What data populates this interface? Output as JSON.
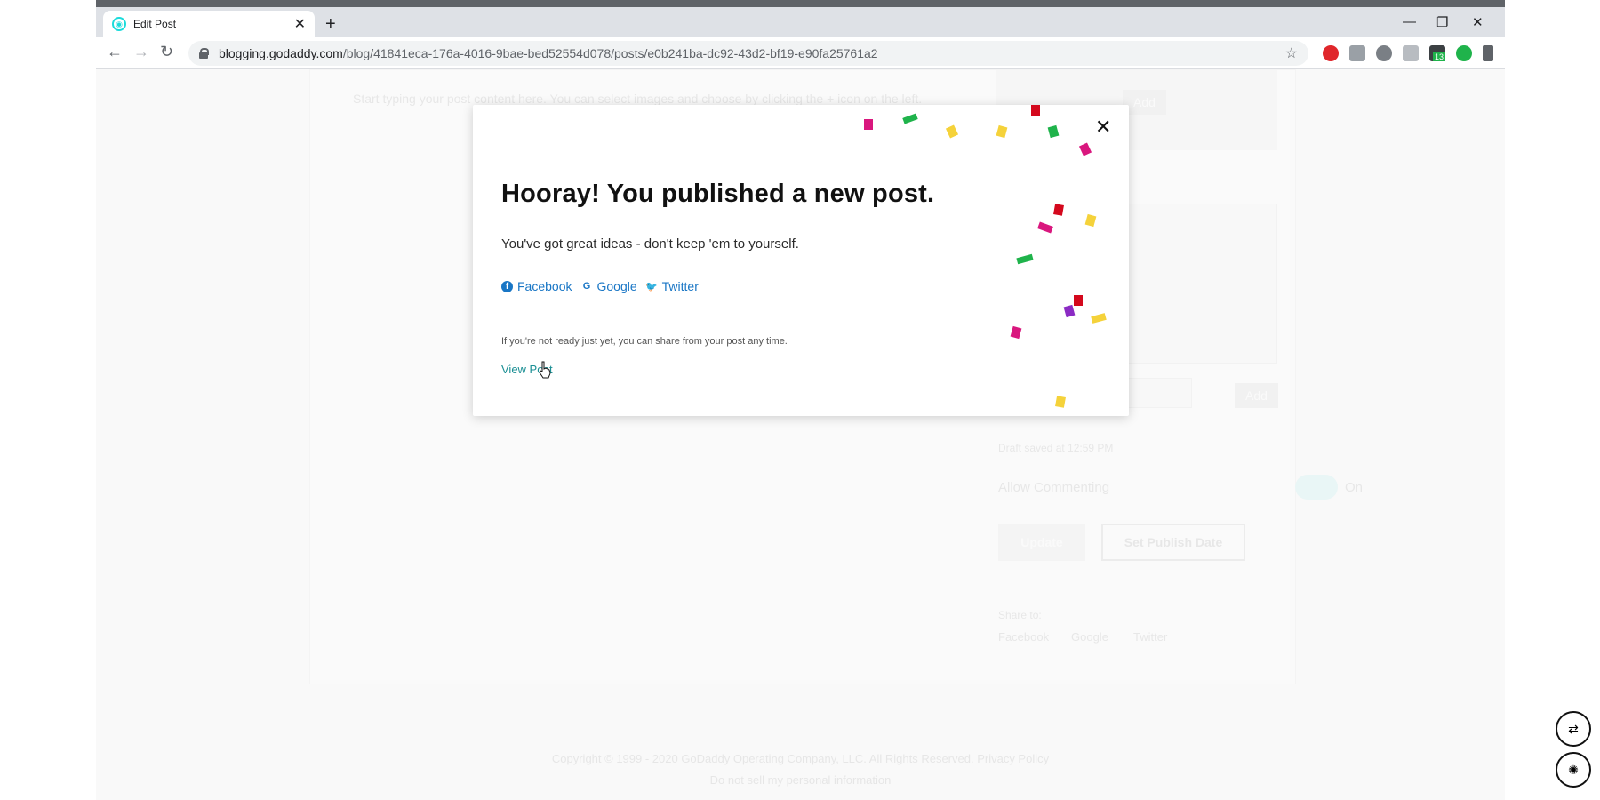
{
  "browser": {
    "tab_title": "Edit Post",
    "tab_close": "✕",
    "new_tab": "+",
    "window_controls": {
      "minimize": "—",
      "restore": "❐",
      "close": "✕"
    },
    "nav": {
      "back": "←",
      "forward": "→",
      "reload": "↻",
      "menu": "⋮"
    },
    "url_host": "blogging.godaddy.com",
    "url_path": "/blog/41841eca-176a-4016-9bae-bed52554d078/posts/e0b241ba-dc92-43d2-bf19-e90fa25761a2",
    "bookmark_icon": "☆",
    "extension_badge": "13"
  },
  "background_page": {
    "editor_hint": "Start typing your post content here. You can select images and choose by clicking the + icon on the left.",
    "add_button": "Add",
    "add_button_2": "Add",
    "draft_saved": "Draft saved at 12:59 PM",
    "allow_commenting": "Allow Commenting",
    "toggle_state": "On",
    "update_button": "Update",
    "set_publish_date_button": "Set Publish Date",
    "share_to": "Share to:",
    "share_links": [
      "Facebook",
      "Google",
      "Twitter"
    ],
    "footer_copyright": "Copyright © 1999 - 2020 GoDaddy Operating Company, LLC. All Rights Reserved.",
    "footer_privacy": "Privacy Policy",
    "footer_do_not_sell": "Do not sell my personal information"
  },
  "modal": {
    "close": "✕",
    "title": "Hooray! You published a new post.",
    "subtitle": "You've got great ideas - don't keep 'em to yourself.",
    "share": [
      {
        "label": "Facebook",
        "icon": "f"
      },
      {
        "label": "Google",
        "icon": "G"
      },
      {
        "label": "Twitter",
        "icon": "🐦"
      }
    ],
    "note": "If you're not ready just yet, you can share from your post any time.",
    "view_post": "View Post"
  },
  "side_widgets": {
    "translate_icon": "⇄",
    "brain_icon": "✺"
  },
  "colors": {
    "link_blue": "#1976c5",
    "view_post_teal": "#1b8f94",
    "confetti_pink": "#d9177e",
    "confetti_green": "#1fb34b",
    "confetti_yellow": "#f5d23a",
    "confetti_red": "#d4081d",
    "confetti_purple": "#8b2bc4"
  }
}
